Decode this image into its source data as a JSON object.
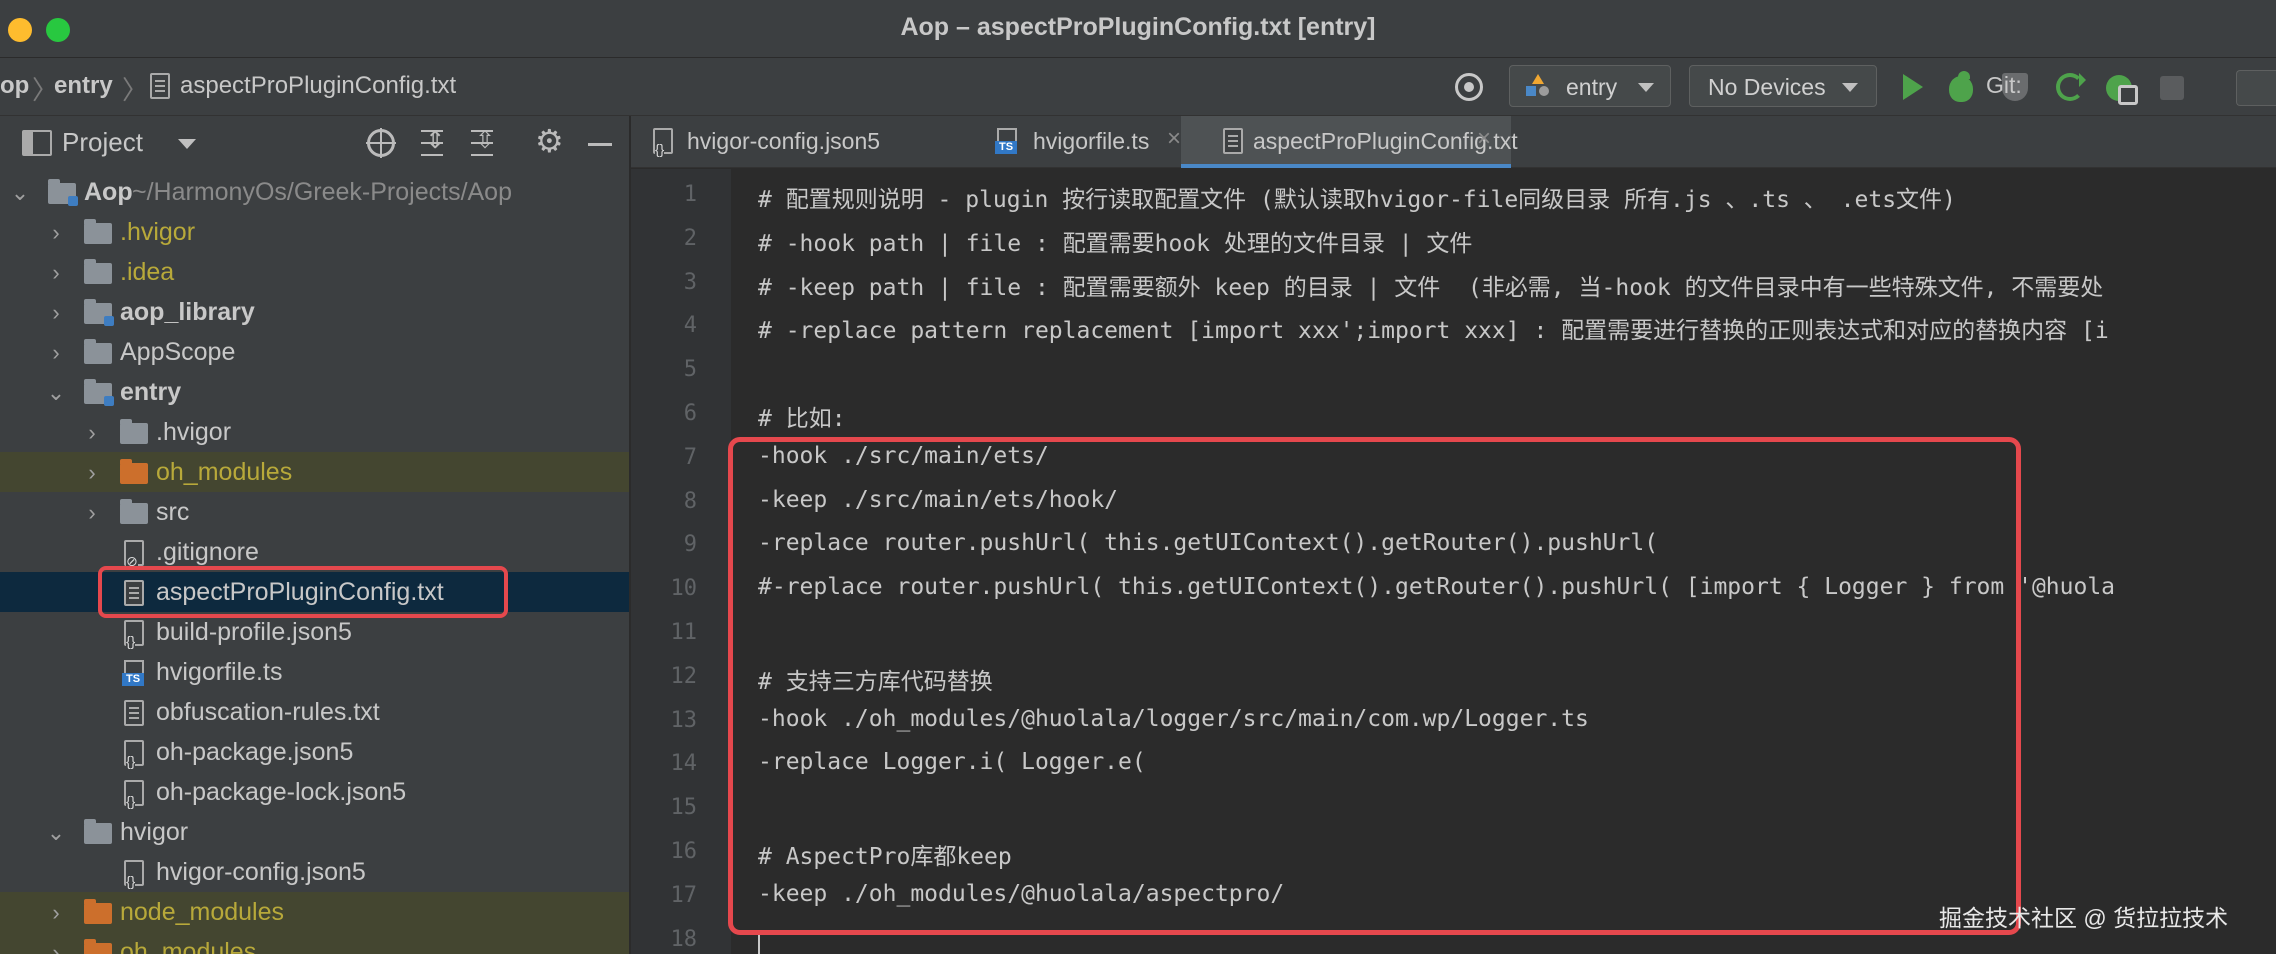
{
  "window": {
    "title": "Aop – aspectProPluginConfig.txt [entry]"
  },
  "nav": {
    "crumbs": [
      "op",
      "entry",
      "aspectProPluginConfig.txt"
    ],
    "config_dropdown": "entry",
    "device_dropdown": "No Devices",
    "git_label": "Git:"
  },
  "project": {
    "title": "Project",
    "items": [
      {
        "label": "Aop",
        "path": "~/HarmonyOs/Greek-Projects/Aop"
      },
      {
        "label": ".hvigor"
      },
      {
        "label": ".idea"
      },
      {
        "label": "aop_library"
      },
      {
        "label": "AppScope"
      },
      {
        "label": "entry"
      },
      {
        "label": ".hvigor"
      },
      {
        "label": "oh_modules"
      },
      {
        "label": "src"
      },
      {
        "label": ".gitignore"
      },
      {
        "label": "aspectProPluginConfig.txt"
      },
      {
        "label": "build-profile.json5"
      },
      {
        "label": "hvigorfile.ts"
      },
      {
        "label": "obfuscation-rules.txt"
      },
      {
        "label": "oh-package.json5"
      },
      {
        "label": "oh-package-lock.json5"
      },
      {
        "label": "hvigor"
      },
      {
        "label": "hvigor-config.json5"
      },
      {
        "label": "node_modules"
      },
      {
        "label": "oh_modules"
      }
    ]
  },
  "tabs": [
    {
      "label": "hvigor-config.json5",
      "icon": "json5-file-icon"
    },
    {
      "label": "hvigorfile.ts",
      "icon": "ts-file-icon"
    },
    {
      "label": "aspectProPluginConfig.txt",
      "icon": "text-file-icon",
      "active": true
    }
  ],
  "editor": {
    "line_numbers": [
      "1",
      "2",
      "3",
      "4",
      "5",
      "6",
      "7",
      "8",
      "9",
      "10",
      "11",
      "12",
      "13",
      "14",
      "15",
      "16",
      "17",
      "18"
    ],
    "lines": [
      "# 配置规则说明 - plugin 按行读取配置文件 (默认读取hvigor-file同级目录 所有.js 、.ts 、 .ets文件)",
      "# -hook path | file : 配置需要hook 处理的文件目录 | 文件",
      "# -keep path | file : 配置需要额外 keep 的目录 | 文件  (非必需, 当-hook 的文件目录中有一些特殊文件, 不需要处",
      "# -replace pattern replacement [import xxx';import xxx] : 配置需要进行替换的正则表达式和对应的替换内容 [i",
      "",
      "# 比如:",
      "-hook ./src/main/ets/",
      "-keep ./src/main/ets/hook/",
      "-replace router.pushUrl( this.getUIContext().getRouter().pushUrl(",
      "#-replace router.pushUrl( this.getUIContext().getRouter().pushUrl( [import { Logger } from '@huola",
      "",
      "# 支持三方库代码替换",
      "-hook ./oh_modules/@huolala/logger/src/main/com.wp/Logger.ts",
      "-replace Logger.i( Logger.e(",
      "",
      "# AspectPro库都keep",
      "-keep ./oh_modules/@huolala/aspectpro/",
      ""
    ]
  },
  "watermark": "掘金技术社区 @ 货拉拉技术"
}
